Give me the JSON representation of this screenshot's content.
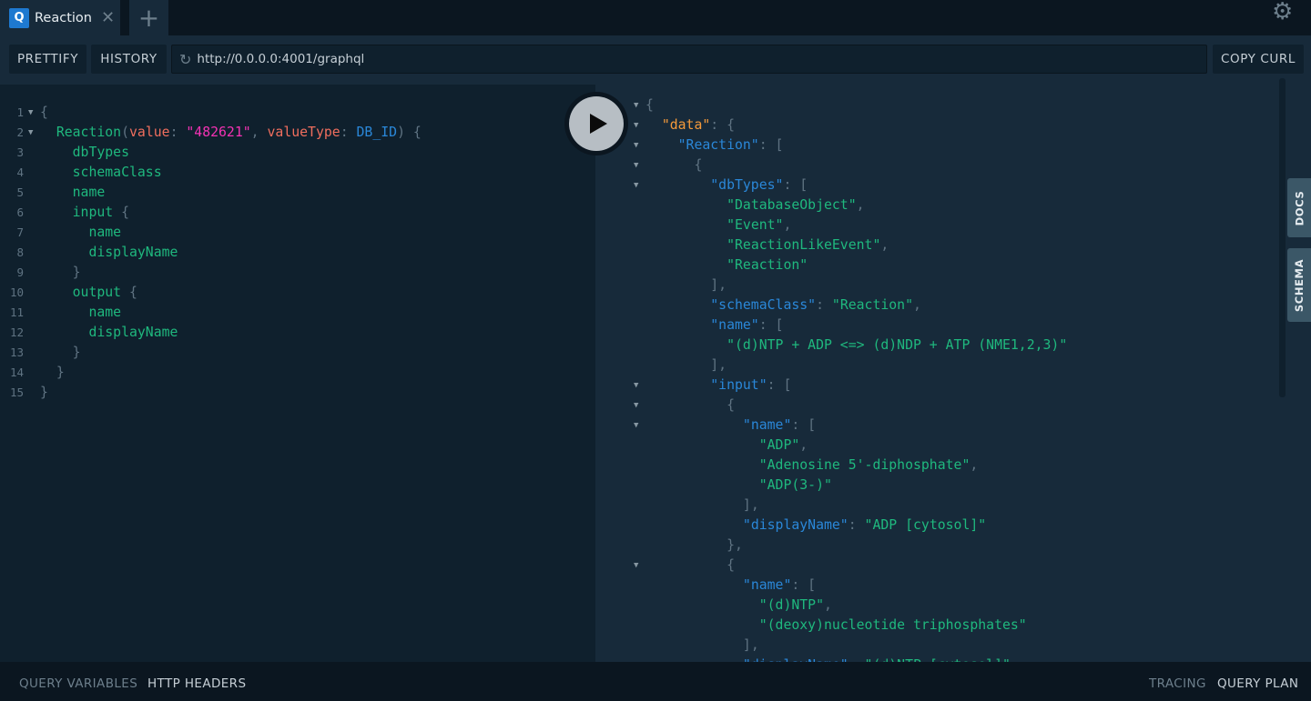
{
  "tabs": [
    {
      "icon": "Q",
      "title": "Reaction",
      "close": "✕"
    }
  ],
  "add_tab": "+",
  "toolbar": {
    "prettify": "PRETTIFY",
    "history": "HISTORY",
    "url": "http://0.0.0.0:4001/graphql",
    "copy_curl": "COPY CURL"
  },
  "side_tabs": {
    "docs": "DOCS",
    "schema": "SCHEMA"
  },
  "bottom": {
    "query_variables": "QUERY VARIABLES",
    "http_headers": "HTTP HEADERS",
    "tracing": "TRACING",
    "query_plan": "QUERY PLAN"
  },
  "colors": {
    "accent": "#1e79d0",
    "field": "#1fb87e",
    "argument": "#f06e5e",
    "variable_string": "#f432b4",
    "enum": "#2a87d8",
    "json_key": "#2a87d8",
    "data_key": "#f59a3a"
  },
  "editor": [
    {
      "n": "1",
      "f": 1,
      "i": 0,
      "t": [
        [
          "p",
          "{"
        ]
      ]
    },
    {
      "n": "2",
      "f": 1,
      "i": 1,
      "t": [
        [
          "f",
          "Reaction"
        ],
        [
          "p",
          "("
        ],
        [
          "a",
          "value"
        ],
        [
          "p",
          ": "
        ],
        [
          "v",
          "\"482621\""
        ],
        [
          "p",
          ", "
        ],
        [
          "a",
          "valueType"
        ],
        [
          "p",
          ": "
        ],
        [
          "e",
          "DB_ID"
        ],
        [
          "p",
          ") {"
        ]
      ]
    },
    {
      "n": "3",
      "i": 2,
      "t": [
        [
          "f",
          "dbTypes"
        ]
      ]
    },
    {
      "n": "4",
      "i": 2,
      "t": [
        [
          "f",
          "schemaClass"
        ]
      ]
    },
    {
      "n": "5",
      "i": 2,
      "t": [
        [
          "f",
          "name"
        ]
      ]
    },
    {
      "n": "6",
      "i": 2,
      "t": [
        [
          "f",
          "input"
        ],
        [
          "p",
          " {"
        ]
      ]
    },
    {
      "n": "7",
      "i": 3,
      "t": [
        [
          "f",
          "name"
        ]
      ]
    },
    {
      "n": "8",
      "i": 3,
      "t": [
        [
          "f",
          "displayName"
        ]
      ]
    },
    {
      "n": "9",
      "i": 2,
      "t": [
        [
          "p",
          "}"
        ]
      ]
    },
    {
      "n": "10",
      "i": 2,
      "t": [
        [
          "f",
          "output"
        ],
        [
          "p",
          " {"
        ]
      ]
    },
    {
      "n": "11",
      "i": 3,
      "t": [
        [
          "f",
          "name"
        ]
      ]
    },
    {
      "n": "12",
      "i": 3,
      "t": [
        [
          "f",
          "displayName"
        ]
      ]
    },
    {
      "n": "13",
      "i": 2,
      "t": [
        [
          "p",
          "}"
        ]
      ]
    },
    {
      "n": "14",
      "i": 1,
      "t": [
        [
          "p",
          "}"
        ]
      ]
    },
    {
      "n": "15",
      "i": 0,
      "t": [
        [
          "p",
          "}"
        ]
      ]
    }
  ],
  "result": [
    {
      "f": 1,
      "i": 0,
      "t": [
        [
          "p",
          "{"
        ]
      ]
    },
    {
      "f": 1,
      "i": 1,
      "t": [
        [
          "d",
          "\"data\""
        ],
        [
          "p",
          ": {"
        ]
      ]
    },
    {
      "f": 1,
      "i": 2,
      "t": [
        [
          "k",
          "\"Reaction\""
        ],
        [
          "p",
          ": ["
        ]
      ]
    },
    {
      "f": 1,
      "i": 3,
      "t": [
        [
          "p",
          "{"
        ]
      ]
    },
    {
      "f": 1,
      "i": 4,
      "t": [
        [
          "k",
          "\"dbTypes\""
        ],
        [
          "p",
          ": ["
        ]
      ]
    },
    {
      "i": 5,
      "t": [
        [
          "s",
          "\"DatabaseObject\""
        ],
        [
          "p",
          ","
        ]
      ]
    },
    {
      "i": 5,
      "t": [
        [
          "s",
          "\"Event\""
        ],
        [
          "p",
          ","
        ]
      ]
    },
    {
      "i": 5,
      "t": [
        [
          "s",
          "\"ReactionLikeEvent\""
        ],
        [
          "p",
          ","
        ]
      ]
    },
    {
      "i": 5,
      "t": [
        [
          "s",
          "\"Reaction\""
        ]
      ]
    },
    {
      "i": 4,
      "t": [
        [
          "p",
          "],"
        ]
      ]
    },
    {
      "i": 4,
      "t": [
        [
          "k",
          "\"schemaClass\""
        ],
        [
          "p",
          ": "
        ],
        [
          "s",
          "\"Reaction\""
        ],
        [
          "p",
          ","
        ]
      ]
    },
    {
      "i": 4,
      "t": [
        [
          "k",
          "\"name\""
        ],
        [
          "p",
          ": ["
        ]
      ]
    },
    {
      "i": 5,
      "t": [
        [
          "s",
          "\"(d)NTP + ADP <=> (d)NDP + ATP (NME1,2,3)\""
        ]
      ]
    },
    {
      "i": 4,
      "t": [
        [
          "p",
          "],"
        ]
      ]
    },
    {
      "f": 1,
      "i": 4,
      "t": [
        [
          "k",
          "\"input\""
        ],
        [
          "p",
          ": ["
        ]
      ]
    },
    {
      "f": 1,
      "i": 5,
      "t": [
        [
          "p",
          "{"
        ]
      ]
    },
    {
      "f": 1,
      "i": 6,
      "t": [
        [
          "k",
          "\"name\""
        ],
        [
          "p",
          ": ["
        ]
      ]
    },
    {
      "i": 7,
      "t": [
        [
          "s",
          "\"ADP\""
        ],
        [
          "p",
          ","
        ]
      ]
    },
    {
      "i": 7,
      "t": [
        [
          "s",
          "\"Adenosine 5'-diphosphate\""
        ],
        [
          "p",
          ","
        ]
      ]
    },
    {
      "i": 7,
      "t": [
        [
          "s",
          "\"ADP(3-)\""
        ]
      ]
    },
    {
      "i": 6,
      "t": [
        [
          "p",
          "],"
        ]
      ]
    },
    {
      "i": 6,
      "t": [
        [
          "k",
          "\"displayName\""
        ],
        [
          "p",
          ": "
        ],
        [
          "s",
          "\"ADP [cytosol]\""
        ]
      ]
    },
    {
      "i": 5,
      "t": [
        [
          "p",
          "},"
        ]
      ]
    },
    {
      "f": 1,
      "i": 5,
      "t": [
        [
          "p",
          "{"
        ]
      ]
    },
    {
      "i": 6,
      "t": [
        [
          "k",
          "\"name\""
        ],
        [
          "p",
          ": ["
        ]
      ]
    },
    {
      "i": 7,
      "t": [
        [
          "s",
          "\"(d)NTP\""
        ],
        [
          "p",
          ","
        ]
      ]
    },
    {
      "i": 7,
      "t": [
        [
          "s",
          "\"(deoxy)nucleotide triphosphates\""
        ]
      ]
    },
    {
      "i": 6,
      "t": [
        [
          "p",
          "],"
        ]
      ]
    },
    {
      "i": 6,
      "t": [
        [
          "k",
          "\"displayName\""
        ],
        [
          "p",
          ": "
        ],
        [
          "s",
          "\"(d)NTP [cytosol]\""
        ]
      ]
    }
  ]
}
